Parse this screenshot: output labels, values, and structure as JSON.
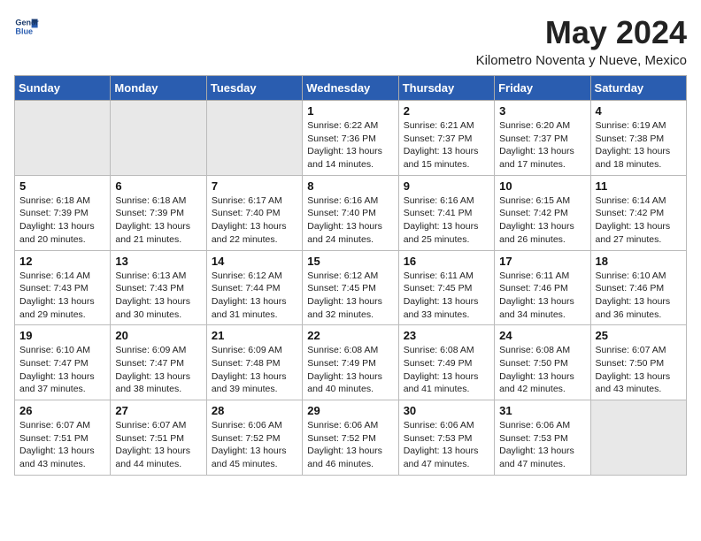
{
  "logo": {
    "line1": "General",
    "line2": "Blue"
  },
  "title": "May 2024",
  "location": "Kilometro Noventa y Nueve, Mexico",
  "weekdays": [
    "Sunday",
    "Monday",
    "Tuesday",
    "Wednesday",
    "Thursday",
    "Friday",
    "Saturday"
  ],
  "weeks": [
    [
      {
        "day": "",
        "info": ""
      },
      {
        "day": "",
        "info": ""
      },
      {
        "day": "",
        "info": ""
      },
      {
        "day": "1",
        "info": "Sunrise: 6:22 AM\nSunset: 7:36 PM\nDaylight: 13 hours\nand 14 minutes."
      },
      {
        "day": "2",
        "info": "Sunrise: 6:21 AM\nSunset: 7:37 PM\nDaylight: 13 hours\nand 15 minutes."
      },
      {
        "day": "3",
        "info": "Sunrise: 6:20 AM\nSunset: 7:37 PM\nDaylight: 13 hours\nand 17 minutes."
      },
      {
        "day": "4",
        "info": "Sunrise: 6:19 AM\nSunset: 7:38 PM\nDaylight: 13 hours\nand 18 minutes."
      }
    ],
    [
      {
        "day": "5",
        "info": "Sunrise: 6:18 AM\nSunset: 7:39 PM\nDaylight: 13 hours\nand 20 minutes."
      },
      {
        "day": "6",
        "info": "Sunrise: 6:18 AM\nSunset: 7:39 PM\nDaylight: 13 hours\nand 21 minutes."
      },
      {
        "day": "7",
        "info": "Sunrise: 6:17 AM\nSunset: 7:40 PM\nDaylight: 13 hours\nand 22 minutes."
      },
      {
        "day": "8",
        "info": "Sunrise: 6:16 AM\nSunset: 7:40 PM\nDaylight: 13 hours\nand 24 minutes."
      },
      {
        "day": "9",
        "info": "Sunrise: 6:16 AM\nSunset: 7:41 PM\nDaylight: 13 hours\nand 25 minutes."
      },
      {
        "day": "10",
        "info": "Sunrise: 6:15 AM\nSunset: 7:42 PM\nDaylight: 13 hours\nand 26 minutes."
      },
      {
        "day": "11",
        "info": "Sunrise: 6:14 AM\nSunset: 7:42 PM\nDaylight: 13 hours\nand 27 minutes."
      }
    ],
    [
      {
        "day": "12",
        "info": "Sunrise: 6:14 AM\nSunset: 7:43 PM\nDaylight: 13 hours\nand 29 minutes."
      },
      {
        "day": "13",
        "info": "Sunrise: 6:13 AM\nSunset: 7:43 PM\nDaylight: 13 hours\nand 30 minutes."
      },
      {
        "day": "14",
        "info": "Sunrise: 6:12 AM\nSunset: 7:44 PM\nDaylight: 13 hours\nand 31 minutes."
      },
      {
        "day": "15",
        "info": "Sunrise: 6:12 AM\nSunset: 7:45 PM\nDaylight: 13 hours\nand 32 minutes."
      },
      {
        "day": "16",
        "info": "Sunrise: 6:11 AM\nSunset: 7:45 PM\nDaylight: 13 hours\nand 33 minutes."
      },
      {
        "day": "17",
        "info": "Sunrise: 6:11 AM\nSunset: 7:46 PM\nDaylight: 13 hours\nand 34 minutes."
      },
      {
        "day": "18",
        "info": "Sunrise: 6:10 AM\nSunset: 7:46 PM\nDaylight: 13 hours\nand 36 minutes."
      }
    ],
    [
      {
        "day": "19",
        "info": "Sunrise: 6:10 AM\nSunset: 7:47 PM\nDaylight: 13 hours\nand 37 minutes."
      },
      {
        "day": "20",
        "info": "Sunrise: 6:09 AM\nSunset: 7:47 PM\nDaylight: 13 hours\nand 38 minutes."
      },
      {
        "day": "21",
        "info": "Sunrise: 6:09 AM\nSunset: 7:48 PM\nDaylight: 13 hours\nand 39 minutes."
      },
      {
        "day": "22",
        "info": "Sunrise: 6:08 AM\nSunset: 7:49 PM\nDaylight: 13 hours\nand 40 minutes."
      },
      {
        "day": "23",
        "info": "Sunrise: 6:08 AM\nSunset: 7:49 PM\nDaylight: 13 hours\nand 41 minutes."
      },
      {
        "day": "24",
        "info": "Sunrise: 6:08 AM\nSunset: 7:50 PM\nDaylight: 13 hours\nand 42 minutes."
      },
      {
        "day": "25",
        "info": "Sunrise: 6:07 AM\nSunset: 7:50 PM\nDaylight: 13 hours\nand 43 minutes."
      }
    ],
    [
      {
        "day": "26",
        "info": "Sunrise: 6:07 AM\nSunset: 7:51 PM\nDaylight: 13 hours\nand 43 minutes."
      },
      {
        "day": "27",
        "info": "Sunrise: 6:07 AM\nSunset: 7:51 PM\nDaylight: 13 hours\nand 44 minutes."
      },
      {
        "day": "28",
        "info": "Sunrise: 6:06 AM\nSunset: 7:52 PM\nDaylight: 13 hours\nand 45 minutes."
      },
      {
        "day": "29",
        "info": "Sunrise: 6:06 AM\nSunset: 7:52 PM\nDaylight: 13 hours\nand 46 minutes."
      },
      {
        "day": "30",
        "info": "Sunrise: 6:06 AM\nSunset: 7:53 PM\nDaylight: 13 hours\nand 47 minutes."
      },
      {
        "day": "31",
        "info": "Sunrise: 6:06 AM\nSunset: 7:53 PM\nDaylight: 13 hours\nand 47 minutes."
      },
      {
        "day": "",
        "info": ""
      }
    ]
  ]
}
